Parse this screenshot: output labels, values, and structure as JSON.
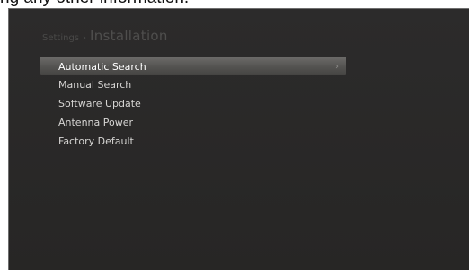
{
  "caption": "ng any other information.",
  "header": {
    "parent": "Settings",
    "separator": "›",
    "title": "Installation"
  },
  "menu": {
    "selected_index": 0,
    "items": [
      {
        "label": "Automatic Search"
      },
      {
        "label": "Manual Search"
      },
      {
        "label": "Software Update"
      },
      {
        "label": "Antenna Power"
      },
      {
        "label": "Factory Default"
      }
    ],
    "submenu_icon": "chevron-right-icon"
  },
  "colors": {
    "background": "#2a2928",
    "text": "#d6d5d3",
    "highlight": "#5a5957",
    "breadcrumb": "#4a4948"
  }
}
